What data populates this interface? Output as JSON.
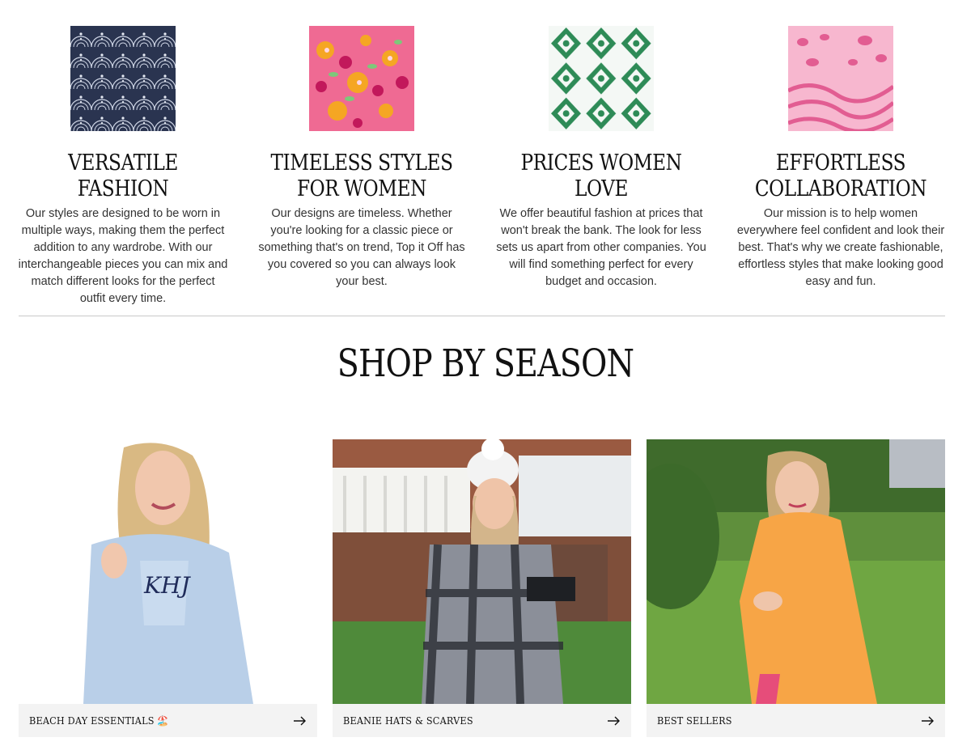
{
  "features": [
    {
      "title": "VERSATILE FASHION",
      "text": "Our styles are designed to be worn in multiple ways, making them the perfect addition to any wardrobe. With our interchangeable pieces you can mix and match different looks for the perfect outfit every time.",
      "pattern": "navy-scallop-pattern",
      "color": "#28324a"
    },
    {
      "title": "TIMELESS STYLES FOR WOMEN",
      "text": "Our designs are timeless. Whether you're looking for a classic piece or something that's on trend, Top it Off has you covered so you can always look your best.",
      "pattern": "pink-floral-pattern",
      "color": "#e8507a"
    },
    {
      "title": "PRICES WOMEN LOVE",
      "text": "We offer beautiful fashion at prices that won't break the bank. The look for less sets us apart from other companies. You will find something perfect for every budget and occasion.",
      "pattern": "green-damask-pattern",
      "color": "#2e8b57"
    },
    {
      "title": "EFFORTLESS COLLABORATION",
      "text": "Our mission is to help women everywhere feel confident and look their best. That's why we create fashionable, effortless styles that make looking good easy and fun.",
      "pattern": "pink-animal-print-pattern",
      "color": "#e9699b"
    }
  ],
  "section": {
    "title": "SHOP BY SEASON"
  },
  "collections": [
    {
      "label": "BEACH DAY ESSENTIALS 🏖️",
      "image": "woman-in-blue-monogram-poncho-photo"
    },
    {
      "label": "BEANIE HATS & SCARVES",
      "image": "woman-in-beanie-and-plaid-scarf-photo"
    },
    {
      "label": "BEST SELLERS",
      "image": "woman-in-orange-poncho-photo"
    }
  ]
}
